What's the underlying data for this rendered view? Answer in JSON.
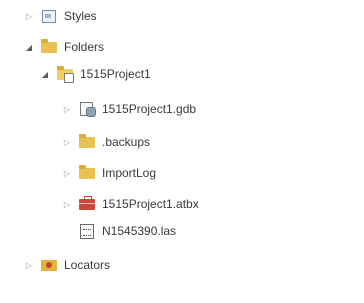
{
  "tree": {
    "styles": {
      "label": "Styles",
      "icon": "styles-icon",
      "expanded": false
    },
    "folders": {
      "label": "Folders",
      "icon": "folder-icon",
      "expanded": true
    },
    "project": {
      "label": "1515Project1",
      "icon": "project-folder-icon",
      "expanded": true
    },
    "children": [
      {
        "label": "1515Project1.gdb",
        "icon": "geodatabase-icon",
        "expandable": true
      },
      {
        "label": ".backups",
        "icon": "folder-icon",
        "expandable": true
      },
      {
        "label": "ImportLog",
        "icon": "folder-icon",
        "expandable": true
      },
      {
        "label": "1515Project1.atbx",
        "icon": "toolbox-icon",
        "expandable": true
      },
      {
        "label": "N1545390.las",
        "icon": "las-file-icon",
        "expandable": false
      }
    ],
    "locators": {
      "label": "Locators",
      "icon": "locators-icon",
      "expanded": false
    }
  }
}
